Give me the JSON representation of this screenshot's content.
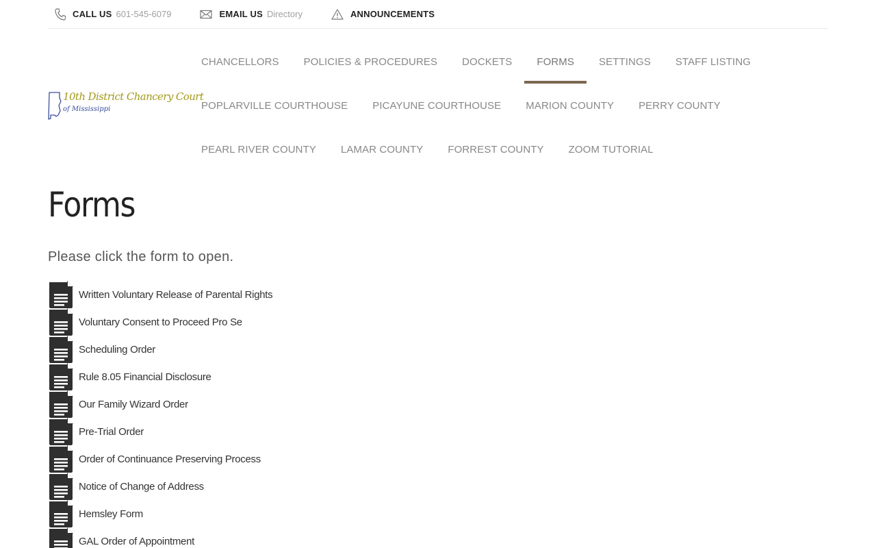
{
  "topbar": {
    "call_label": "CALL US",
    "call_value": "601-545-6079",
    "email_label": "EMAIL US",
    "email_value": "Directory",
    "announcements_label": "ANNOUNCEMENTS"
  },
  "logo": {
    "line1": "10th District Chancery Court",
    "line2": "of Mississippi",
    "colors": {
      "gold": "#a39a1c",
      "blue": "#3a4f9a"
    }
  },
  "nav": {
    "row1": [
      "CHANCELLORS",
      "POLICIES & PROCEDURES",
      "DOCKETS",
      "FORMS",
      "SETTINGS",
      "STAFF LISTING"
    ],
    "row2": [
      "POPLARVILLE COURTHOUSE",
      "PICAYUNE COURTHOUSE",
      "MARION COUNTY",
      "PERRY COUNTY"
    ],
    "row3": [
      "PEARL RIVER COUNTY",
      "LAMAR COUNTY",
      "FORREST COUNTY",
      "ZOOM TUTORIAL"
    ],
    "active": "FORMS",
    "active_color": "#7a6650"
  },
  "page": {
    "title": "Forms",
    "intro": "Please click the form to open."
  },
  "forms": [
    "Written Voluntary Release of Parental Rights",
    "Voluntary Consent to Proceed Pro Se",
    "Scheduling Order",
    "Rule 8.05 Financial Disclosure",
    "Our Family Wizard Order",
    "Pre-Trial Order",
    "Order of Continuance Preserving Process",
    "Notice of Change of Address",
    "Hemsley Form",
    "GAL Order of Appointment"
  ],
  "icons": {
    "phone": "phone-icon",
    "email": "envelope-icon",
    "announcements": "warning-triangle-icon",
    "form": "document-icon"
  }
}
